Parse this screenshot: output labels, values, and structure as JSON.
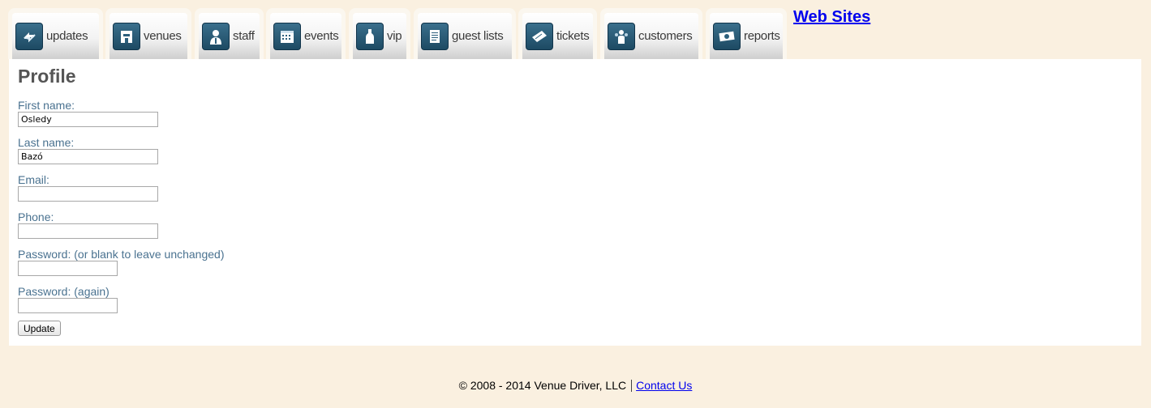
{
  "nav": {
    "tabs": [
      {
        "label": "updates",
        "icon": "updates-icon"
      },
      {
        "label": "venues",
        "icon": "venue-icon"
      },
      {
        "label": "staff",
        "icon": "staff-person-icon"
      },
      {
        "label": "events",
        "icon": "calendar-icon"
      },
      {
        "label": "vip",
        "icon": "bottle-icon"
      },
      {
        "label": "guest lists",
        "icon": "list-document-icon"
      },
      {
        "label": "tickets",
        "icon": "tickets-icon"
      },
      {
        "label": "customers",
        "icon": "customers-icon"
      },
      {
        "label": "reports",
        "icon": "money-report-icon"
      }
    ],
    "websites_link": "Web Sites"
  },
  "profile": {
    "title": "Profile",
    "first_name": {
      "label": "First name:",
      "value": "Osledy"
    },
    "last_name": {
      "label": "Last name:",
      "value": "Bazó"
    },
    "email": {
      "label": "Email:",
      "value": ""
    },
    "phone": {
      "label": "Phone:",
      "value": ""
    },
    "password": {
      "label": "Password: (or blank to leave unchanged)",
      "value": ""
    },
    "password_again": {
      "label": "Password: (again)",
      "value": ""
    },
    "update_button": "Update"
  },
  "footer": {
    "copyright": "© 2008 - 2014 Venue Driver, LLC",
    "contact_link": "Contact Us"
  },
  "colors": {
    "page_bg": "#faf0e0",
    "label_text": "#4a7290",
    "icon_blue": "#2c5f7c",
    "link": "#0000ee"
  }
}
